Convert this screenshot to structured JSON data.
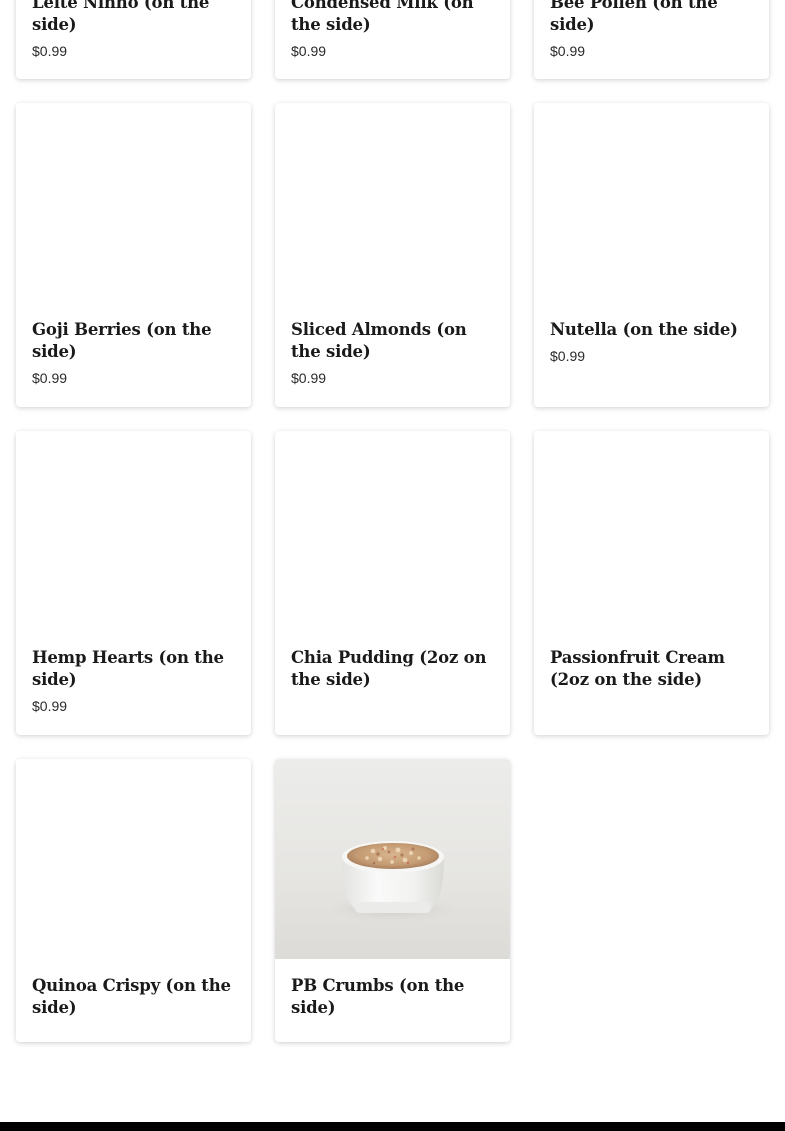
{
  "colors": {
    "background": "#ffffff",
    "text": "#1a1a1a",
    "footer": "#000000"
  },
  "menu_items": [
    {
      "title": "Leite Ninho (on the side)",
      "price": "$0.99",
      "image": "none"
    },
    {
      "title": "Condensed Milk (on the side)",
      "price": "$0.99",
      "image": "none"
    },
    {
      "title": "Bee Pollen (on the side)",
      "price": "$0.99",
      "image": "none"
    },
    {
      "title": "Goji Berries (on the side)",
      "price": "$0.99",
      "image": "none"
    },
    {
      "title": "Sliced Almonds (on the side)",
      "price": "$0.99",
      "image": "none"
    },
    {
      "title": "Nutella (on the side)",
      "price": "$0.99",
      "image": "none"
    },
    {
      "title": "Hemp Hearts (on the side)",
      "price": "$0.99",
      "image": "none"
    },
    {
      "title": "Chia Pudding (2oz on the side)",
      "price": "",
      "image": "none"
    },
    {
      "title": "Passionfruit Cream (2oz on the side)",
      "price": "",
      "image": "none"
    },
    {
      "title": "Quinoa Crispy (on the side)",
      "price": "",
      "image": "none"
    },
    {
      "title": "PB Crumbs (on the side)",
      "price": "",
      "image": "bowl-of-crumbs-photo"
    }
  ]
}
